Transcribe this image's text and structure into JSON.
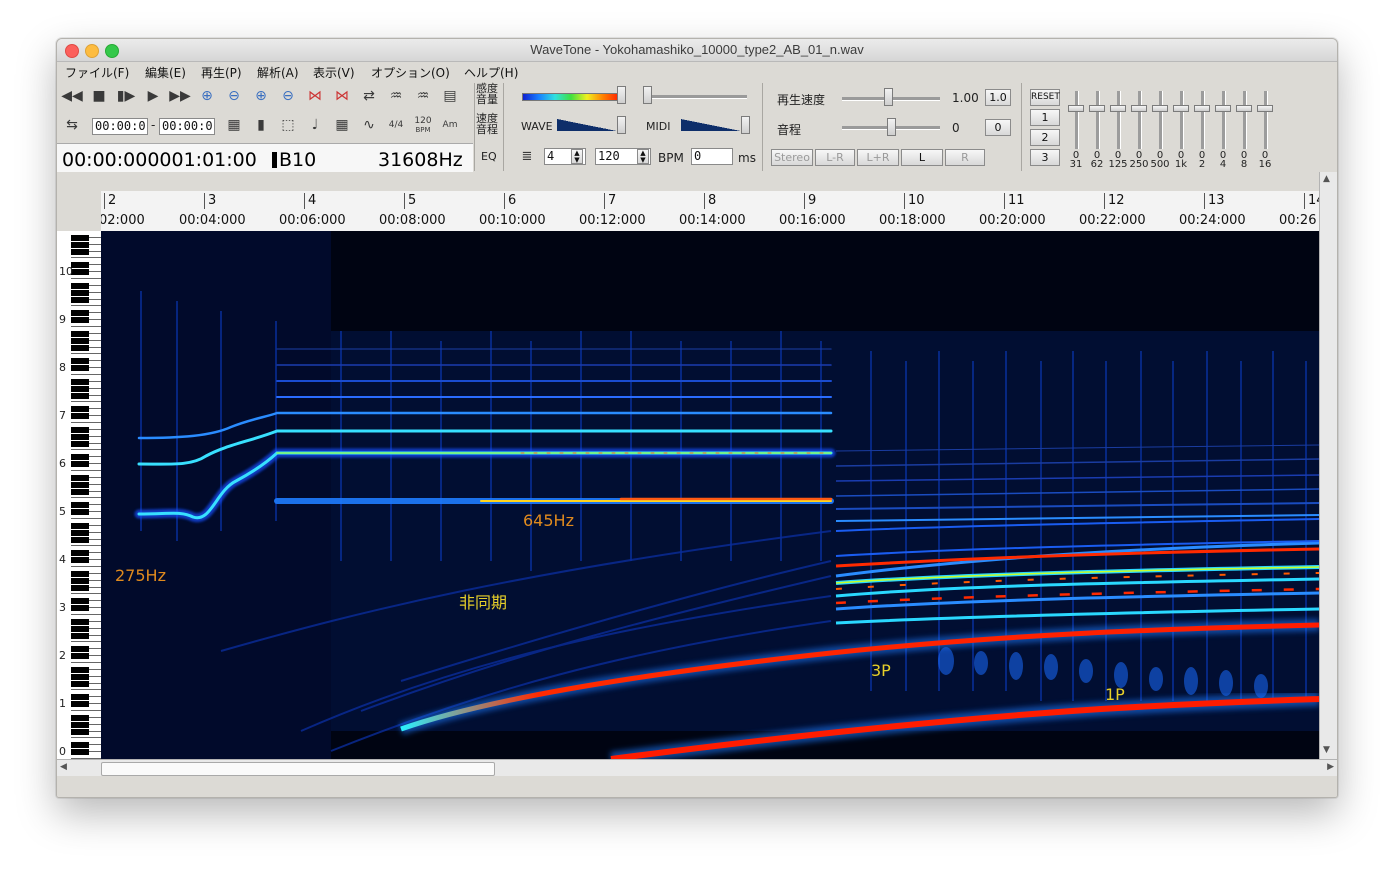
{
  "window": {
    "title": "WaveTone - Yokohamashiko_10000_type2_AB_01_n.wav"
  },
  "menu": [
    "ファイル(F)",
    "編集(E)",
    "再生(P)",
    "解析(A)",
    "表示(V)",
    "オプション(O)",
    "ヘルプ(H)"
  ],
  "toolbar": {
    "row1_icons": [
      "rewind-icon",
      "stop-icon",
      "step-play-icon",
      "play-icon",
      "fast-forward-icon",
      "zoom-in-h-icon",
      "zoom-out-h-icon",
      "zoom-in-v-icon",
      "zoom-out-v-icon",
      "expand-h-icon",
      "shrink-h-icon",
      "swap-icon",
      "wave-in-icon",
      "wave-out-icon",
      "book-icon"
    ],
    "row2_icons": [
      "loop-icon"
    ],
    "range_start": "00:00:0",
    "range_end": "00:00:0",
    "time_sig": "4/4",
    "bpm_small": "120",
    "bpm_small_label": "BPM",
    "chord_label": "Am",
    "position": "00:00:000001:01:00",
    "note": "B10",
    "frequency": "31608Hz"
  },
  "sensitivity": {
    "label1": "感度",
    "label2": "音量",
    "label3": "速度",
    "label4": "音程",
    "eq": "EQ",
    "wave_label": "WAVE",
    "midi_label": "MIDI",
    "beats": "4",
    "bpm": "120",
    "bpm_label": "BPM",
    "ms_value": "0",
    "ms_label": "ms"
  },
  "playback": {
    "speed_label": "再生速度",
    "speed_value": "1.00",
    "speed_reset": "1.0",
    "pitch_label": "音程",
    "pitch_value": "0",
    "pitch_reset": "0",
    "channels": [
      "Stereo",
      "L-R",
      "L+R",
      "L",
      "R"
    ]
  },
  "equalizer": {
    "reset": "RESET",
    "presets": [
      "1",
      "2",
      "3"
    ],
    "values": [
      "0",
      "0",
      "0",
      "0",
      "0",
      "0",
      "0",
      "0",
      "0",
      "0"
    ],
    "freqs": [
      "31",
      "62",
      "125",
      "250",
      "500",
      "1k",
      "2",
      "4",
      "8",
      "16"
    ]
  },
  "ruler": {
    "measures": [
      "2",
      "3",
      "4",
      "5",
      "6",
      "7",
      "8",
      "9",
      "10",
      "11",
      "12",
      "13",
      "14"
    ],
    "times": [
      "02:000",
      "00:04:000",
      "00:06:000",
      "00:08:000",
      "00:10:000",
      "00:12:000",
      "00:14:000",
      "00:16:000",
      "00:18:000",
      "00:20:000",
      "00:22:000",
      "00:24:000",
      "00:26"
    ]
  },
  "piano": {
    "octaves": [
      "0",
      "1",
      "2",
      "3",
      "4",
      "5",
      "6",
      "7",
      "8",
      "9",
      "10"
    ]
  },
  "annotations": {
    "f275": "275Hz",
    "f645": "645Hz",
    "async": "非同期",
    "p3": "3P",
    "p1": "1P"
  },
  "colors": {
    "annotation_orange": "#e08a1e",
    "annotation_yellow": "#e6cf2a",
    "spectrogram_bg": "#000412"
  }
}
